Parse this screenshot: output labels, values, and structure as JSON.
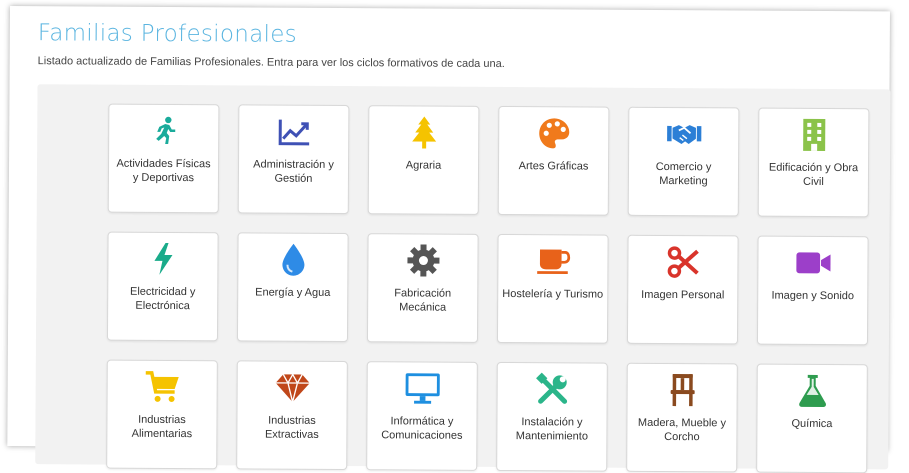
{
  "page": {
    "title": "Familias Profesionales",
    "subtitle": "Listado actualizado de Familias Profesionales. Entra para ver los ciclos formativos de cada una."
  },
  "families": [
    {
      "label": "Actividades Físicas y Deportivas",
      "icon": "running-person-icon",
      "color": "#1aab9b"
    },
    {
      "label": "Administración y Gestión",
      "icon": "line-chart-icon",
      "color": "#3f51b5"
    },
    {
      "label": "Agraria",
      "icon": "tree-icon",
      "color": "#f5c300"
    },
    {
      "label": "Artes Gráficas",
      "icon": "palette-icon",
      "color": "#f07a1c"
    },
    {
      "label": "Comercio y Marketing",
      "icon": "handshake-icon",
      "color": "#2c7fd6"
    },
    {
      "label": "Edificación y Obra Civil",
      "icon": "building-icon",
      "color": "#8bc34a"
    },
    {
      "label": "Electricidad y Electrónica",
      "icon": "lightning-bolt-icon",
      "color": "#1aab8a"
    },
    {
      "label": "Energía y Agua",
      "icon": "water-drop-icon",
      "color": "#2e8be6"
    },
    {
      "label": "Fabricación Mecánica",
      "icon": "gear-icon",
      "color": "#555555"
    },
    {
      "label": "Hostelería y Turismo",
      "icon": "coffee-cup-icon",
      "color": "#e8621a"
    },
    {
      "label": "Imagen Personal",
      "icon": "scissors-icon",
      "color": "#d9342b"
    },
    {
      "label": "Imagen y Sonido",
      "icon": "video-camera-icon",
      "color": "#9c3fc9"
    },
    {
      "label": "Industrias Alimentarias",
      "icon": "shopping-cart-icon",
      "color": "#f5c300"
    },
    {
      "label": "Industrias Extractivas",
      "icon": "diamond-icon",
      "color": "#c0471a"
    },
    {
      "label": "Informática y Comunicaciones",
      "icon": "monitor-icon",
      "color": "#1e8fe0"
    },
    {
      "label": "Instalación y Mantenimiento",
      "icon": "tools-icon",
      "color": "#2bb58a"
    },
    {
      "label": "Madera, Mueble y Corcho",
      "icon": "chair-icon",
      "color": "#8a4a1f"
    },
    {
      "label": "Química",
      "icon": "flask-icon",
      "color": "#2e9c4f"
    }
  ]
}
